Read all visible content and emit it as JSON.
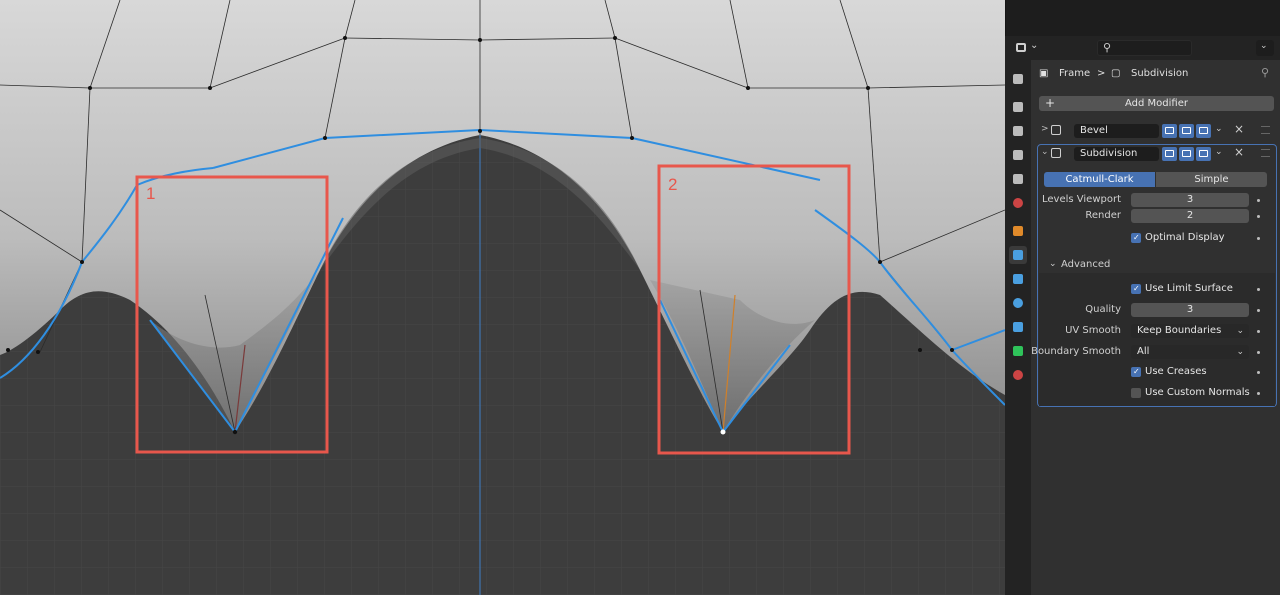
{
  "viewport": {
    "callouts": [
      {
        "label": "1"
      },
      {
        "label": "2"
      }
    ],
    "colors": {
      "background": "#3d3d3d",
      "mesh": "#c2c2c2",
      "edges_selected": "#2f8ee0",
      "callout": "#e8574c"
    }
  },
  "header": {
    "editor_type_icon": "properties-editor-icon",
    "search_placeholder": "",
    "options_icon": "chevron-down-icon"
  },
  "tabs": [
    {
      "name": "tool",
      "icon": "tool-icon",
      "color": "#bbbbbb"
    },
    {
      "name": "render",
      "icon": "render-icon",
      "color": "#bbbbbb"
    },
    {
      "name": "output",
      "icon": "output-icon",
      "color": "#bbbbbb"
    },
    {
      "name": "view-layer",
      "icon": "view-layer-icon",
      "color": "#bbbbbb"
    },
    {
      "name": "scene",
      "icon": "scene-icon",
      "color": "#bbbbbb"
    },
    {
      "name": "world",
      "icon": "world-icon",
      "color": "#cc4444"
    },
    {
      "name": "object",
      "icon": "object-icon",
      "color": "#e08a2a"
    },
    {
      "name": "modifiers",
      "icon": "wrench-icon",
      "color": "#4a9fe0",
      "active": true
    },
    {
      "name": "particles",
      "icon": "particles-icon",
      "color": "#4a9fe0"
    },
    {
      "name": "physics",
      "icon": "physics-icon",
      "color": "#4a9fe0"
    },
    {
      "name": "constraints",
      "icon": "constraints-icon",
      "color": "#4a9fe0"
    },
    {
      "name": "data",
      "icon": "mesh-data-icon",
      "color": "#2fc35a"
    },
    {
      "name": "material",
      "icon": "material-icon",
      "color": "#cc4444"
    }
  ],
  "breadcrumb": {
    "object": "Frame",
    "separator": ">",
    "modifier": "Subdivision"
  },
  "add_modifier": "Add Modifier",
  "modifiers": [
    {
      "name": "Bevel",
      "expanded": false
    },
    {
      "name": "Subdivision",
      "expanded": true
    }
  ],
  "subdivision": {
    "mode_options": [
      "Catmull-Clark",
      "Simple"
    ],
    "mode_selected": "Catmull-Clark",
    "levels_viewport_label": "Levels Viewport",
    "levels_viewport": "3",
    "render_label": "Render",
    "render": "2",
    "optimal_display_label": "Optimal Display",
    "optimal_display": true,
    "advanced_label": "Advanced",
    "use_limit_surface_label": "Use Limit Surface",
    "use_limit_surface": true,
    "quality_label": "Quality",
    "quality": "3",
    "uv_smooth_label": "UV Smooth",
    "uv_smooth": "Keep Boundaries",
    "boundary_smooth_label": "Boundary Smooth",
    "boundary_smooth": "All",
    "use_creases_label": "Use Creases",
    "use_creases": true,
    "use_custom_normals_label": "Use Custom Normals",
    "use_custom_normals": false
  }
}
